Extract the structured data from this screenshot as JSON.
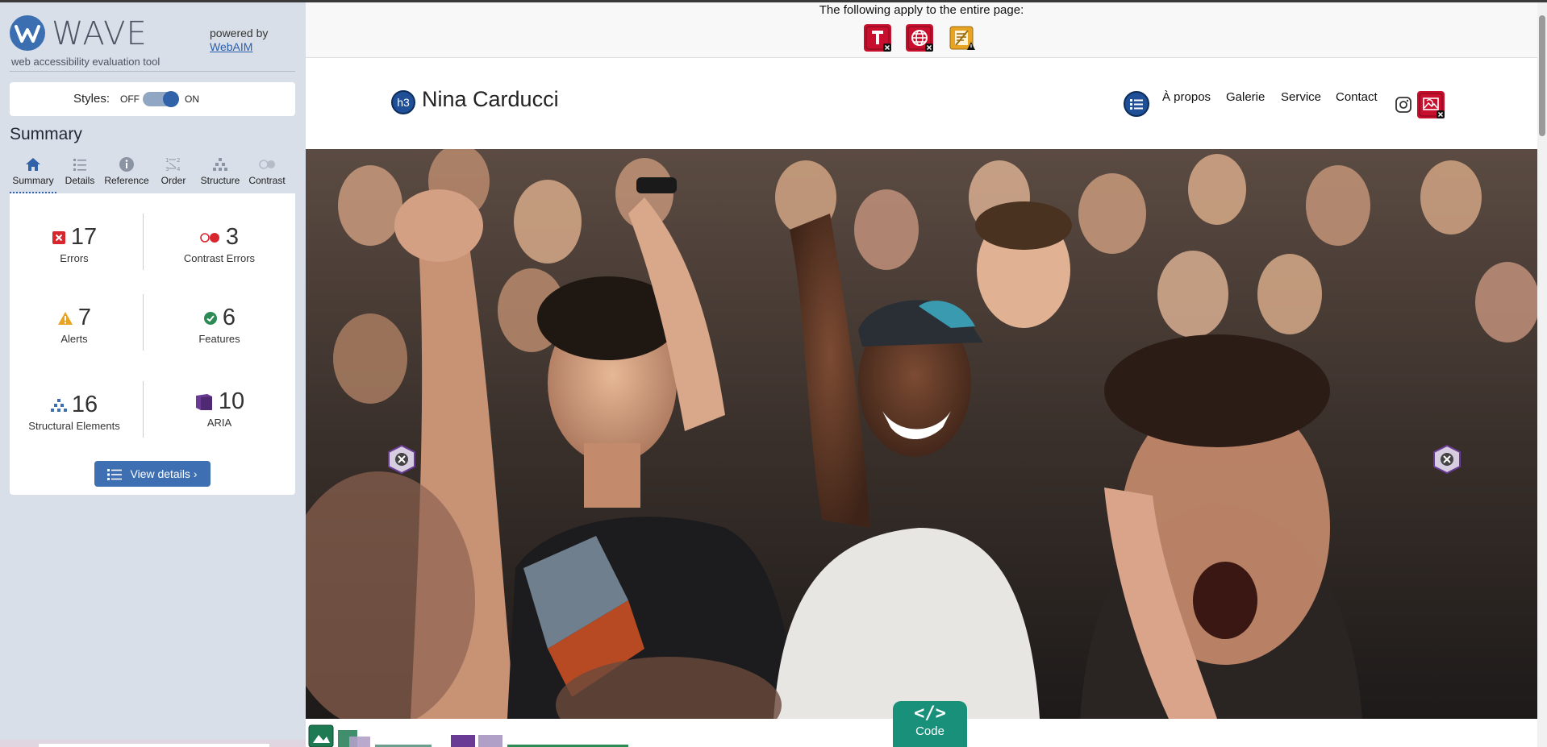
{
  "colors": {
    "accent": "#2f62a9",
    "error": "#d8262f",
    "alert": "#e7a321",
    "feature": "#2c8a55",
    "aria": "#6a3b94",
    "code": "#19907a"
  },
  "wave": {
    "title": "WAVE",
    "subtitle": "web accessibility evaluation tool",
    "powered_by": "powered by",
    "webaim_link": "WebAIM",
    "styles": {
      "label": "Styles:",
      "off": "OFF",
      "on": "ON",
      "state": "on"
    },
    "summary_heading": "Summary",
    "tabs": [
      {
        "label": "Summary",
        "icon": "home-icon",
        "active": true
      },
      {
        "label": "Details",
        "icon": "list-icon"
      },
      {
        "label": "Reference",
        "icon": "info-icon"
      },
      {
        "label": "Order",
        "icon": "order-icon"
      },
      {
        "label": "Structure",
        "icon": "hierarchy-icon"
      },
      {
        "label": "Contrast",
        "icon": "contrast-icon"
      }
    ],
    "stats": {
      "errors": {
        "count": "17",
        "label": "Errors",
        "icon": "error-icon"
      },
      "contrast": {
        "count": "3",
        "label": "Contrast Errors",
        "icon": "contrast-error-icon"
      },
      "alerts": {
        "count": "7",
        "label": "Alerts",
        "icon": "alert-icon"
      },
      "features": {
        "count": "6",
        "label": "Features",
        "icon": "feature-check-icon"
      },
      "structure": {
        "count": "16",
        "label": "Structural Elements",
        "icon": "structure-icon"
      },
      "aria": {
        "count": "10",
        "label": "ARIA",
        "icon": "aria-icon"
      }
    },
    "view_details": "View details ›"
  },
  "page": {
    "entire_page_text": "The following apply to the entire page:",
    "page_flags": [
      "missing-title-icon",
      "missing-language-icon",
      "noscript-alert-icon"
    ],
    "site_title": "Nina Carducci",
    "heading_badge": "h3",
    "nav": [
      "À propos",
      "Galerie",
      "Service",
      "Contact"
    ],
    "code_label": "Code",
    "code_glyph": "</>"
  }
}
